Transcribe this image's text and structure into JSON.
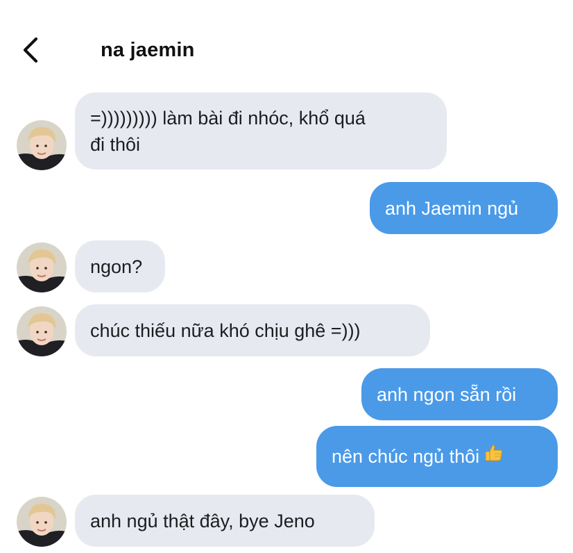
{
  "header": {
    "title": "na jaemin",
    "back_icon": "chevron-left-icon"
  },
  "colors": {
    "incoming_bubble": "#e6eaf0",
    "outgoing_bubble": "#4a9ae8",
    "outgoing_text": "#ffffff",
    "incoming_text": "#1d1d1f"
  },
  "messages": [
    {
      "direction": "in",
      "text": "=))))))))) làm bài đi nhóc, khổ quá\nđi thôi",
      "avatar": "avatar-icon"
    },
    {
      "direction": "out",
      "text": "anh Jaemin ngủ"
    },
    {
      "direction": "in",
      "text": "ngon?",
      "avatar": "avatar-icon"
    },
    {
      "direction": "in",
      "text": "chúc thiếu nữa khó chịu ghê =)))",
      "avatar": "avatar-icon"
    },
    {
      "direction": "out",
      "text": "anh ngon sẵn rồi"
    },
    {
      "direction": "out",
      "text": "nên chúc ngủ thôi",
      "emoji": "thumbs-up-icon"
    },
    {
      "direction": "in",
      "text": "anh ngủ thật đây, bye Jeno",
      "avatar": "avatar-icon"
    }
  ]
}
